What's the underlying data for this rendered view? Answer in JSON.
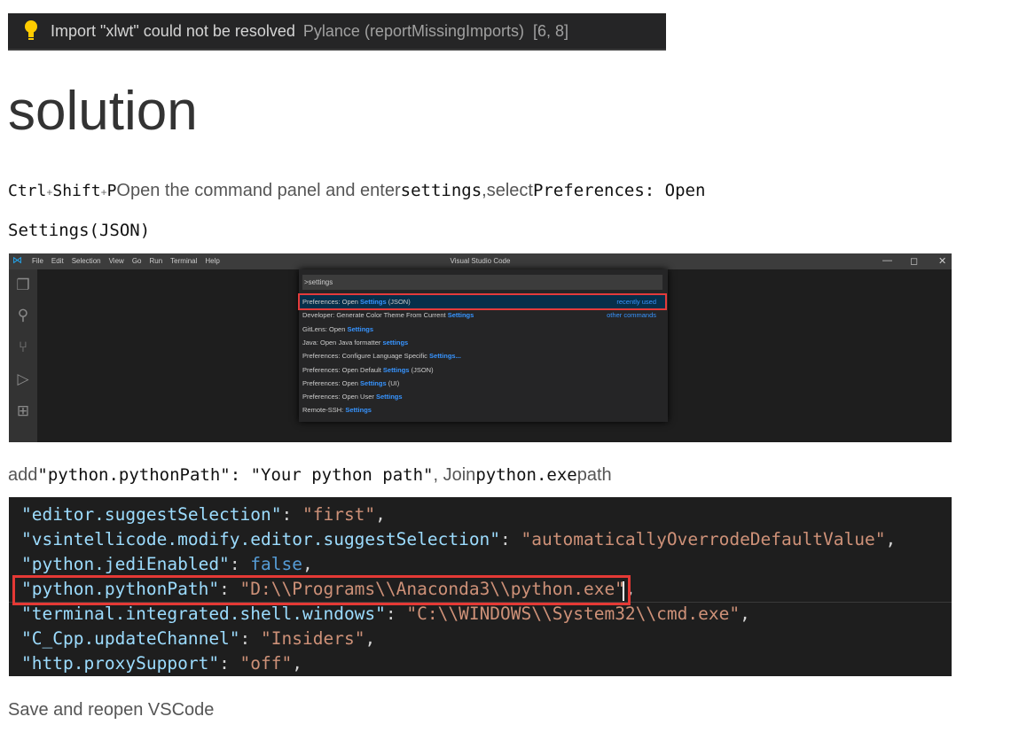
{
  "error_banner": {
    "message": "Import \"xlwt\" could not be resolved",
    "source": "Pylance (reportMissingImports)",
    "position": "[6, 8]",
    "icon": "lightbulb-icon"
  },
  "heading": "solution",
  "step1": {
    "key1": "Ctrl",
    "plus": "+",
    "key2": "Shift",
    "key3": "P",
    "text1": "Open the command panel and enter",
    "code1": "settings",
    "text2": ",select",
    "code2": "Preferences: Open",
    "code3": "Settings(JSON)"
  },
  "vscode": {
    "menus": [
      "File",
      "Edit",
      "Selection",
      "View",
      "Go",
      "Run",
      "Terminal",
      "Help"
    ],
    "window_title": "Visual Studio Code",
    "controls": {
      "minimize": "—",
      "restore": "◻",
      "close": "✕"
    },
    "input_value": ">settings",
    "items": [
      {
        "pre": "Preferences: Open ",
        "hl": "Settings",
        "post": " (JSON)",
        "right": "recently used"
      },
      {
        "pre": "Developer: Generate Color Theme From Current ",
        "hl": "Settings",
        "post": "",
        "right": "other commands"
      },
      {
        "pre": "GitLens: Open ",
        "hl": "Settings",
        "post": "",
        "right": ""
      },
      {
        "pre": "Java: Open Java formatter ",
        "hl": "settings",
        "post": "",
        "right": ""
      },
      {
        "pre": "Preferences: Configure Language Specific ",
        "hl": "Settings...",
        "post": "",
        "right": ""
      },
      {
        "pre": "Preferences: Open Default ",
        "hl": "Settings",
        "post": " (JSON)",
        "right": ""
      },
      {
        "pre": "Preferences: Open ",
        "hl": "Settings",
        "post": " (UI)",
        "right": ""
      },
      {
        "pre": "Preferences: Open User ",
        "hl": "Settings",
        "post": "",
        "right": ""
      },
      {
        "pre": "Remote-SSH: ",
        "hl": "Settings",
        "post": "",
        "right": ""
      }
    ]
  },
  "step2": {
    "text1": "add",
    "code1": "\"python.pythonPath\": \"Your python path\"",
    "text2": ", Join",
    "code2": "python.exe",
    "text3": "path"
  },
  "json_lines": [
    {
      "key": "\"editor.suggestSelection\"",
      "value": "\"first\"",
      "bool": false
    },
    {
      "key": "\"vsintellicode.modify.editor.suggestSelection\"",
      "value": "\"automaticallyOverrodeDefaultValue\"",
      "bool": false
    },
    {
      "key": "\"python.jediEnabled\"",
      "value": "false",
      "bool": true
    },
    {
      "key": "\"python.pythonPath\"",
      "value": "\"D:\\\\Programs\\\\Anaconda3\\\\python.exe\"",
      "bool": false
    },
    {
      "key": "\"terminal.integrated.shell.windows\"",
      "value": "\"C:\\\\WINDOWS\\\\System32\\\\cmd.exe\"",
      "bool": false
    },
    {
      "key": "\"C_Cpp.updateChannel\"",
      "value": "\"Insiders\"",
      "bool": false
    },
    {
      "key": "\"http.proxySupport\"",
      "value": "\"off\"",
      "bool": false
    }
  ],
  "footer": "Save and reopen VSCode"
}
